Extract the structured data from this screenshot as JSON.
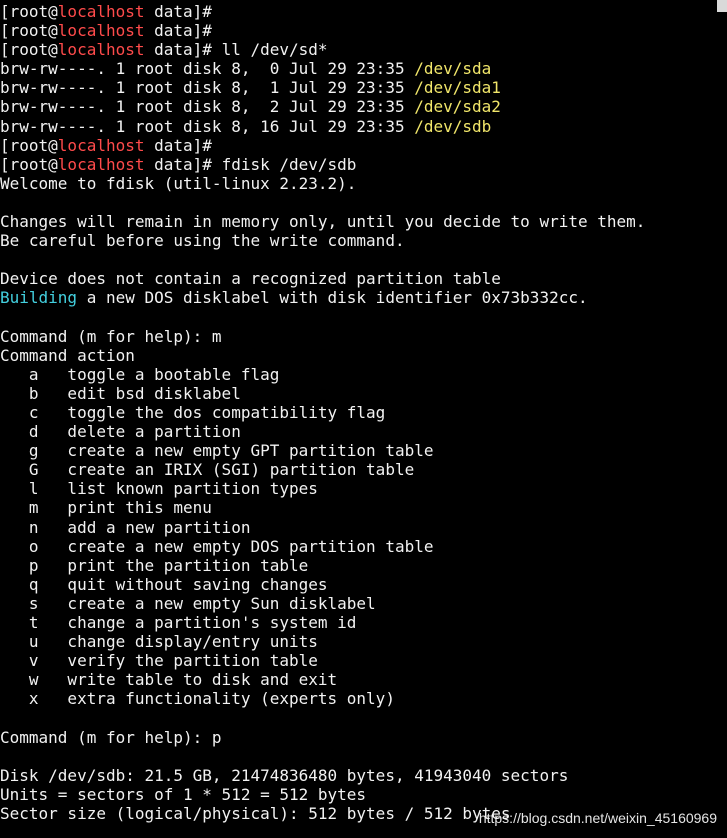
{
  "terminal": {
    "lines": [
      [
        {
          "t": "[root@"
        },
        {
          "t": "localhost",
          "c": "red"
        },
        {
          "t": " data]#"
        }
      ],
      [
        {
          "t": "[root@"
        },
        {
          "t": "localhost",
          "c": "red"
        },
        {
          "t": " data]#"
        }
      ],
      [
        {
          "t": "[root@"
        },
        {
          "t": "localhost",
          "c": "red"
        },
        {
          "t": " data]# ll /dev/sd*"
        }
      ],
      [
        {
          "t": "brw-rw----. 1 root disk 8,  0 Jul 29 23:35 "
        },
        {
          "t": "/dev/sda",
          "c": "yellow"
        }
      ],
      [
        {
          "t": "brw-rw----. 1 root disk 8,  1 Jul 29 23:35 "
        },
        {
          "t": "/dev/sda1",
          "c": "yellow"
        }
      ],
      [
        {
          "t": "brw-rw----. 1 root disk 8,  2 Jul 29 23:35 "
        },
        {
          "t": "/dev/sda2",
          "c": "yellow"
        }
      ],
      [
        {
          "t": "brw-rw----. 1 root disk 8, 16 Jul 29 23:35 "
        },
        {
          "t": "/dev/sdb",
          "c": "yellow"
        }
      ],
      [
        {
          "t": "[root@"
        },
        {
          "t": "localhost",
          "c": "red"
        },
        {
          "t": " data]#"
        }
      ],
      [
        {
          "t": "[root@"
        },
        {
          "t": "localhost",
          "c": "red"
        },
        {
          "t": " data]# fdisk /dev/sdb"
        }
      ],
      [
        {
          "t": "Welcome to fdisk (util-linux 2.23.2)."
        }
      ],
      [
        {
          "t": ""
        }
      ],
      [
        {
          "t": "Changes will remain in memory only, until you decide to write them."
        }
      ],
      [
        {
          "t": "Be careful before using the write command."
        }
      ],
      [
        {
          "t": ""
        }
      ],
      [
        {
          "t": "Device does not contain a recognized partition table"
        }
      ],
      [
        {
          "t": "Building",
          "c": "cyan"
        },
        {
          "t": " a new DOS disklabel with disk identifier 0x73b332cc."
        }
      ],
      [
        {
          "t": ""
        }
      ],
      [
        {
          "t": "Command (m for help): m"
        }
      ],
      [
        {
          "t": "Command action"
        }
      ],
      [
        {
          "t": "   a   toggle a bootable flag"
        }
      ],
      [
        {
          "t": "   b   edit bsd disklabel"
        }
      ],
      [
        {
          "t": "   c   toggle the dos compatibility flag"
        }
      ],
      [
        {
          "t": "   d   delete a partition"
        }
      ],
      [
        {
          "t": "   g   create a new empty GPT partition table"
        }
      ],
      [
        {
          "t": "   G   create an IRIX (SGI) partition table"
        }
      ],
      [
        {
          "t": "   l   list known partition types"
        }
      ],
      [
        {
          "t": "   m   print this menu"
        }
      ],
      [
        {
          "t": "   n   add a new partition"
        }
      ],
      [
        {
          "t": "   o   create a new empty DOS partition table"
        }
      ],
      [
        {
          "t": "   p   print the partition table"
        }
      ],
      [
        {
          "t": "   q   quit without saving changes"
        }
      ],
      [
        {
          "t": "   s   create a new empty Sun disklabel"
        }
      ],
      [
        {
          "t": "   t   change a partition's system id"
        }
      ],
      [
        {
          "t": "   u   change display/entry units"
        }
      ],
      [
        {
          "t": "   v   verify the partition table"
        }
      ],
      [
        {
          "t": "   w   write table to disk and exit"
        }
      ],
      [
        {
          "t": "   x   extra functionality (experts only)"
        }
      ],
      [
        {
          "t": ""
        }
      ],
      [
        {
          "t": "Command (m for help): p"
        }
      ],
      [
        {
          "t": ""
        }
      ],
      [
        {
          "t": "Disk /dev/sdb: 21.5 GB, 21474836480 bytes, 41943040 sectors"
        }
      ],
      [
        {
          "t": "Units = sectors of 1 * 512 = 512 bytes"
        }
      ],
      [
        {
          "t": "Sector size (logical/physical): 512 bytes / 512 bytes"
        }
      ]
    ]
  },
  "watermark": "https://blog.csdn.net/weixin_45160969"
}
